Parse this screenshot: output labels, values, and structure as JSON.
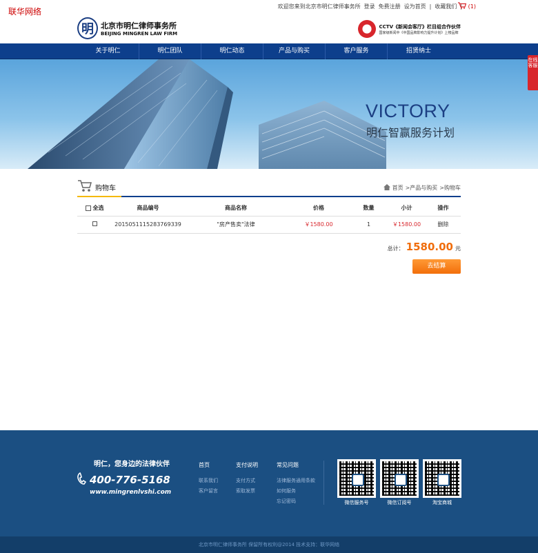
{
  "site_tag": "联华网络",
  "topbar": {
    "welcome": "欢迎您来到北京市明仁律师事务所",
    "login": "登录",
    "register": "免费注册",
    "set_home": "设为首页",
    "favorite": "收藏我们",
    "cart_count": "(1)"
  },
  "header": {
    "logo_cn": "北京市明仁律师事务所",
    "logo_en": "BEIJING MINGREN LAW FIRM",
    "logo_mark": "明",
    "partner_line1": "CCTV《新闻会客厅》栏目组合作伙伴",
    "partner_line2": "国家级新闻中《中国品牌影响力提升计划》上榜品牌"
  },
  "nav": {
    "items": [
      "关于明仁",
      "明仁团队",
      "明仁动态",
      "产品与购买",
      "客户服务",
      "招贤纳士"
    ]
  },
  "banner": {
    "headline": "VICTORY",
    "subtitle": "明仁智赢服务计划"
  },
  "side_service": "在线客服",
  "cart": {
    "title": "购物车",
    "breadcrumb": [
      "首页",
      ">产品与购买",
      ">购物车"
    ],
    "columns": {
      "select_all": "全选",
      "product_no": "商品编号",
      "product_name": "商品名称",
      "price": "价格",
      "quantity": "数量",
      "subtotal": "小计",
      "action": "操作"
    },
    "rows": [
      {
        "product_no": "2015051115283769339",
        "product_name": "\"房产售卖\"法律",
        "price": "￥1580.00",
        "quantity": "1",
        "subtotal": "￥1580.00",
        "action": "删除"
      }
    ],
    "total_label": "总计：",
    "total_amount": "1580.00",
    "total_unit": "元",
    "checkout_label": "去结算"
  },
  "footer": {
    "slogan": "明仁，您身边的法律伙伴",
    "phone": "400-776-5168",
    "url": "www.mingrenlvshi.com",
    "columns": [
      {
        "heading": "首页",
        "links": [
          "联系我们",
          "客户留言"
        ]
      },
      {
        "heading": "支付说明",
        "links": [
          "支付方式",
          "索取发票"
        ]
      },
      {
        "heading": "常见问题",
        "links": [
          "法律服务通用条款",
          "如何服务",
          "忘记密码"
        ]
      }
    ],
    "qrcodes": [
      "微信服务号",
      "微信订阅号",
      "淘宝商城"
    ],
    "copyright": "北京市明仁律师事务所 保留所有权利@2014 技术支持：联华网络"
  },
  "colors": {
    "nav_blue": "#0d3f8c",
    "footer_blue": "#1b4f82",
    "accent_orange": "#f06d0c",
    "price_red": "#d8262c"
  }
}
